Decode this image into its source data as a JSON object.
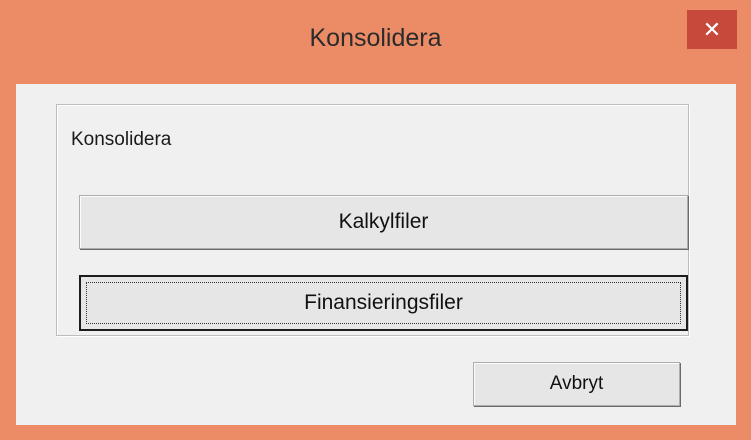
{
  "window": {
    "title": "Konsolidera",
    "close_glyph": "✕"
  },
  "group": {
    "label": "Konsolidera",
    "buttons": {
      "kalkylfiler": "Kalkylfiler",
      "finansieringsfiler": "Finansieringsfiler"
    }
  },
  "footer": {
    "cancel_label": "Avbryt"
  },
  "colors": {
    "title_bar": "#ec8c66",
    "close_button": "#c7493c",
    "client_background": "#f0f0f0"
  }
}
